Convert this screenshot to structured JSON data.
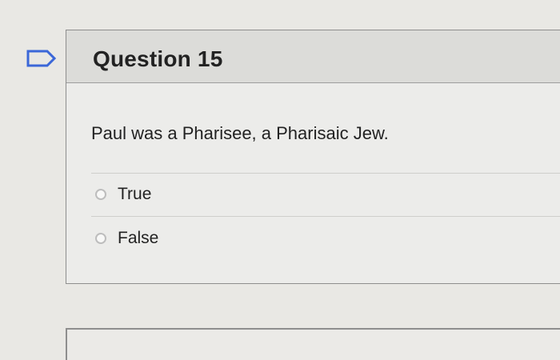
{
  "question": {
    "title": "Question 15",
    "prompt": "Paul was a Pharisee, a Pharisaic Jew.",
    "options": [
      {
        "label": "True",
        "selected": false
      },
      {
        "label": "False",
        "selected": false
      }
    ]
  },
  "icons": {
    "bookmark": "bookmark-icon",
    "radio_unselected": "radio-unselected-icon"
  },
  "colors": {
    "background": "#e9e8e4",
    "header": "#dcdcd9",
    "border": "#8e8e8e",
    "bookmark_outline": "#3b67d8",
    "text": "#222222"
  }
}
